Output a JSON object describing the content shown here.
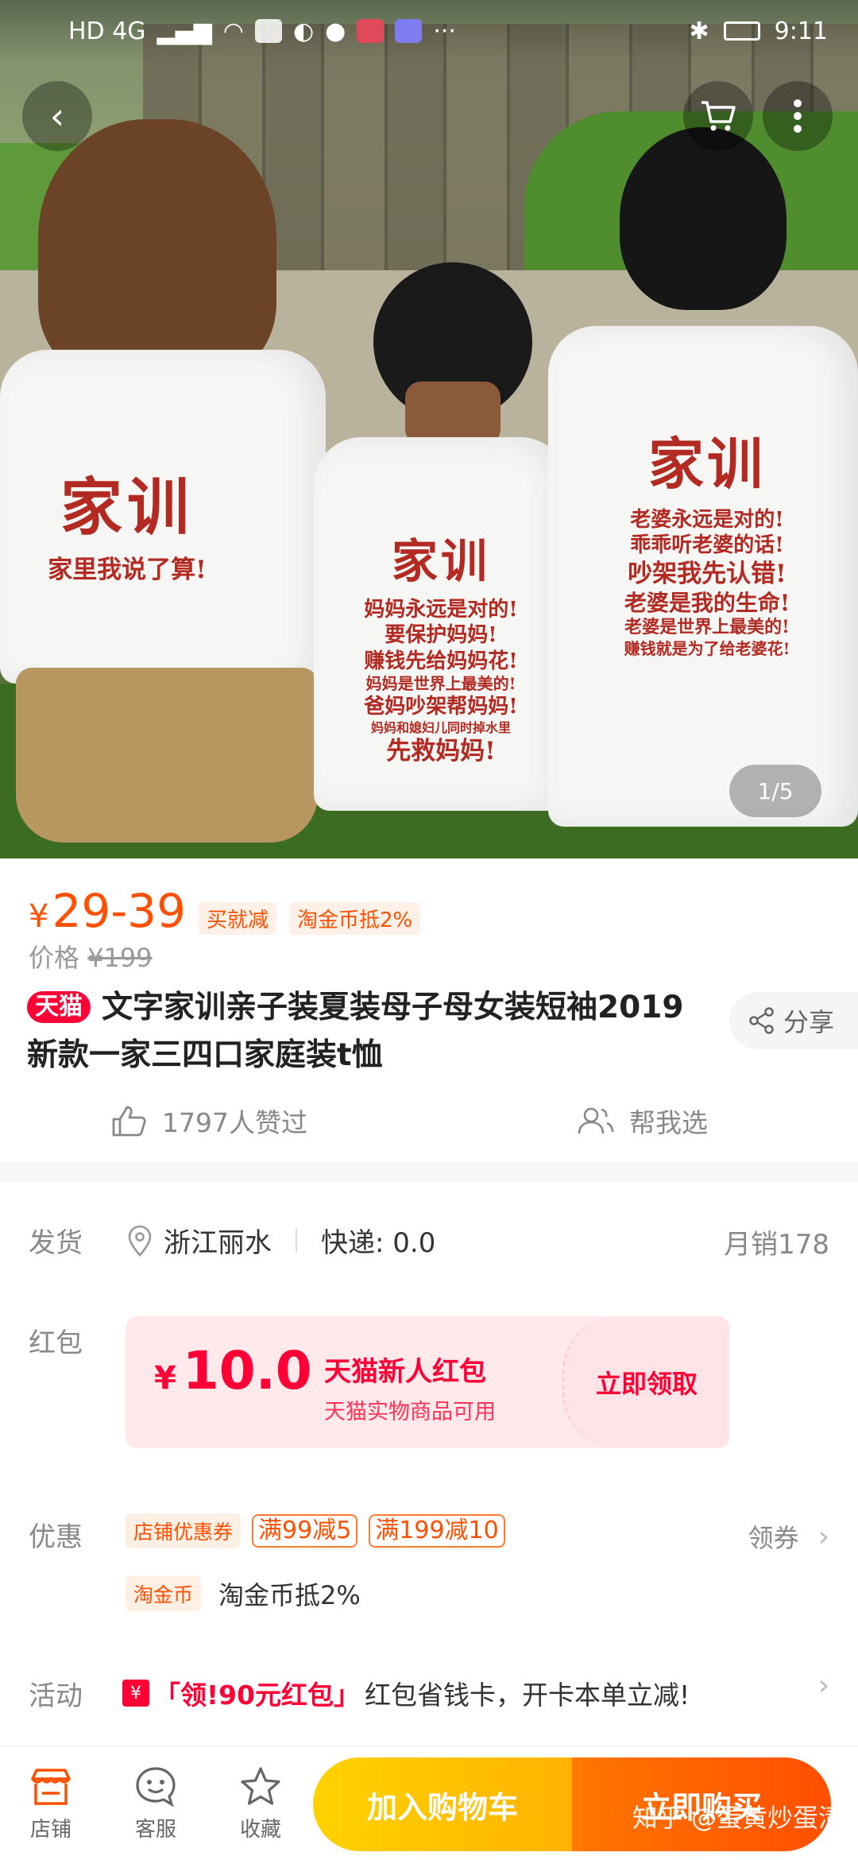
{
  "status_bar": {
    "left": "HD 4G",
    "time": "9:11",
    "more": "···"
  },
  "hero": {
    "pager": "1/5",
    "shirt_left": {
      "title": "家训",
      "line": "家里我说了算!"
    },
    "shirt_child": {
      "title": "家训",
      "lines": [
        "妈妈永远是对的!",
        "要保护妈妈!",
        "赚钱先给妈妈花!",
        "妈妈是世界上最美的!",
        "爸妈吵架帮妈妈!",
        "妈妈和媳妇儿同时掉水里",
        "先救妈妈!"
      ]
    },
    "shirt_right": {
      "title": "家训",
      "lines": [
        "老婆永远是对的!",
        "乖乖听老婆的话!",
        "吵架我先认错!",
        "老婆是我的生命!",
        "老婆是世界上最美的!",
        "赚钱就是为了给老婆花!"
      ]
    }
  },
  "price": {
    "currency": "¥",
    "range": "29-39",
    "tag1": "买就减",
    "tag2": "淘金币抵2%",
    "orig_label": "价格",
    "orig_value": "¥199"
  },
  "product": {
    "badge": "天猫",
    "title": "文字家训亲子装夏装母子母女装短袖2019新款一家三四口家庭装t恤",
    "share": "分享",
    "likes": "1797人赞过",
    "help": "帮我选"
  },
  "shipping": {
    "label": "发货",
    "origin": "浙江丽水",
    "express": "快递: 0.0",
    "monthly": "月销178"
  },
  "redpacket": {
    "label": "红包",
    "currency": "¥",
    "amount": "10.0",
    "title": "天猫新人红包",
    "subtitle": "天猫实物商品可用",
    "action": "立即领取"
  },
  "discount": {
    "label": "优惠",
    "store_coupon": "店铺优惠券",
    "c1": "满99减5",
    "c2": "满199减10",
    "get": "领券",
    "coin_tag": "淘金币",
    "coin_text": "淘金币抵2%"
  },
  "activity": {
    "label": "活动",
    "red_text": "「领!90元红包」",
    "text": "红包省钱卡，开卡本单立减!"
  },
  "bottom": {
    "store": "店铺",
    "service": "客服",
    "favorite": "收藏",
    "cart": "加入购物车",
    "buy": "立即购买",
    "watermark": "知乎 @蛋黄炒蛋清"
  },
  "colors": {
    "accent": "#ff5000",
    "tmall": "#ff0036",
    "cart": "#ffb300",
    "buy": "#ff4e00"
  }
}
